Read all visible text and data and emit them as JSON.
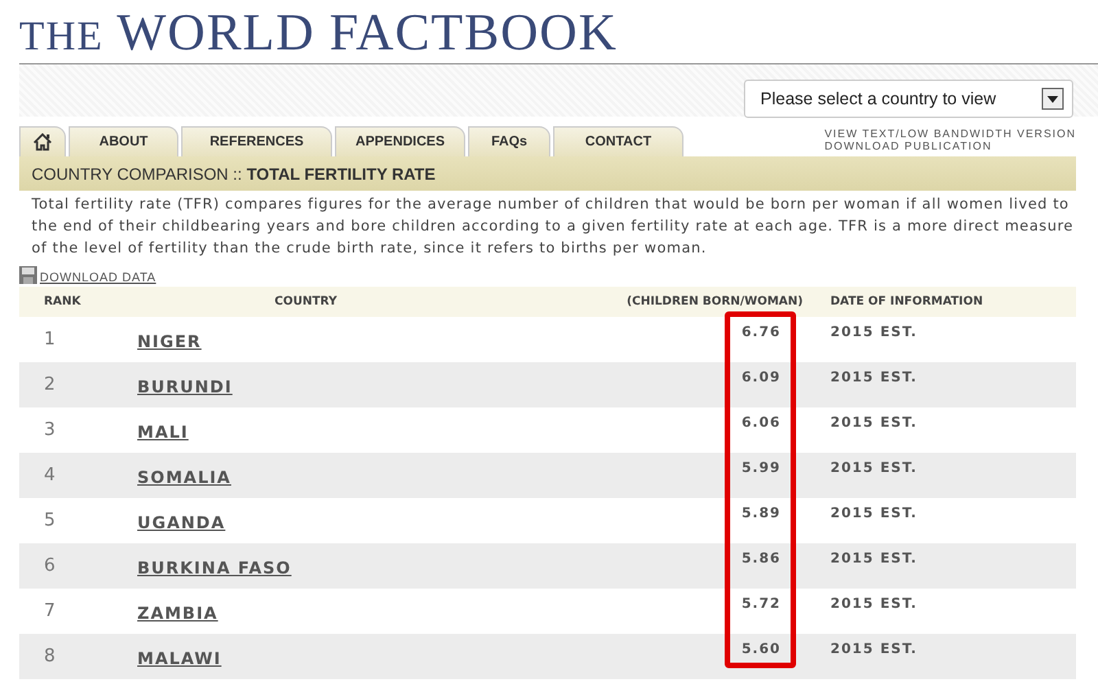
{
  "header": {
    "logo_small": "THE",
    "logo_large": "WORLD FACTBOOK"
  },
  "country_select": {
    "placeholder": "Please select a country to view"
  },
  "tabs": [
    {
      "kind": "home"
    },
    {
      "kind": "text",
      "label": "ABOUT"
    },
    {
      "kind": "text",
      "label": "REFERENCES"
    },
    {
      "kind": "text",
      "label": "APPENDICES"
    },
    {
      "kind": "text",
      "label": "FAQs"
    },
    {
      "kind": "text",
      "label": "CONTACT"
    }
  ],
  "side_links": [
    "VIEW TEXT/LOW BANDWIDTH VERSION",
    "DOWNLOAD PUBLICATION"
  ],
  "section": {
    "prefix": "COUNTRY COMPARISON :: ",
    "title": "TOTAL FERTILITY RATE"
  },
  "description": "Total fertility rate (TFR) compares figures for the average number of children that would be born per woman if all women lived to the end of their childbearing years and bore children according to a given fertility rate at each age. TFR is a more direct measure of the level of fertility than the crude birth rate, since it refers to births per woman.",
  "download": "DOWNLOAD DATA",
  "table": {
    "columns": [
      "RANK",
      "COUNTRY",
      "(CHILDREN BORN/WOMAN)",
      "DATE OF INFORMATION"
    ],
    "rows": [
      {
        "rank": "1",
        "country": "NIGER",
        "value": "6.76",
        "date": "2015 EST."
      },
      {
        "rank": "2",
        "country": "BURUNDI",
        "value": "6.09",
        "date": "2015 EST."
      },
      {
        "rank": "3",
        "country": "MALI",
        "value": "6.06",
        "date": "2015 EST."
      },
      {
        "rank": "4",
        "country": "SOMALIA",
        "value": "5.99",
        "date": "2015 EST."
      },
      {
        "rank": "5",
        "country": "UGANDA",
        "value": "5.89",
        "date": "2015 EST."
      },
      {
        "rank": "6",
        "country": "BURKINA FASO",
        "value": "5.86",
        "date": "2015 EST."
      },
      {
        "rank": "7",
        "country": "ZAMBIA",
        "value": "5.72",
        "date": "2015 EST."
      },
      {
        "rank": "8",
        "country": "MALAWI",
        "value": "5.60",
        "date": "2015 EST."
      }
    ]
  },
  "highlight": {
    "color": "#e00000"
  }
}
